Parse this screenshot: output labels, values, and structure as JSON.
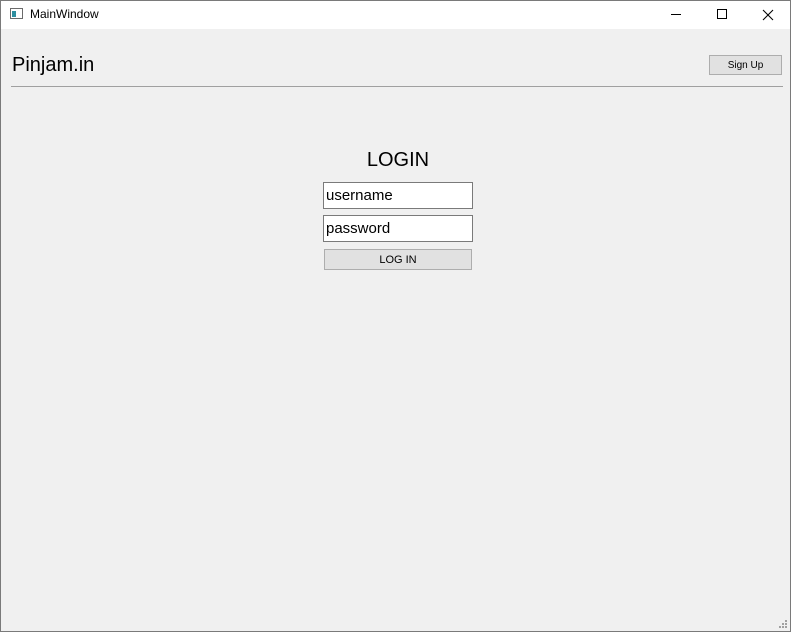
{
  "window": {
    "title": "MainWindow",
    "controls": [
      "minimize",
      "maximize",
      "close"
    ]
  },
  "header": {
    "brand": "Pinjam.in",
    "signup_label": "Sign Up"
  },
  "login": {
    "title": "LOGIN",
    "username_placeholder": "username",
    "password_placeholder": "password",
    "username_value": "",
    "password_value": "",
    "button_label": "LOG IN"
  },
  "icons": {
    "app": "app-window-icon",
    "minimize": "minimize-icon",
    "maximize": "maximize-icon",
    "close": "close-icon",
    "resize": "resize-grip-icon"
  },
  "colors": {
    "window_bg": "#f0f0f0",
    "titlebar_bg": "#ffffff",
    "button_bg": "#e1e1e1",
    "button_border": "#adadad"
  }
}
